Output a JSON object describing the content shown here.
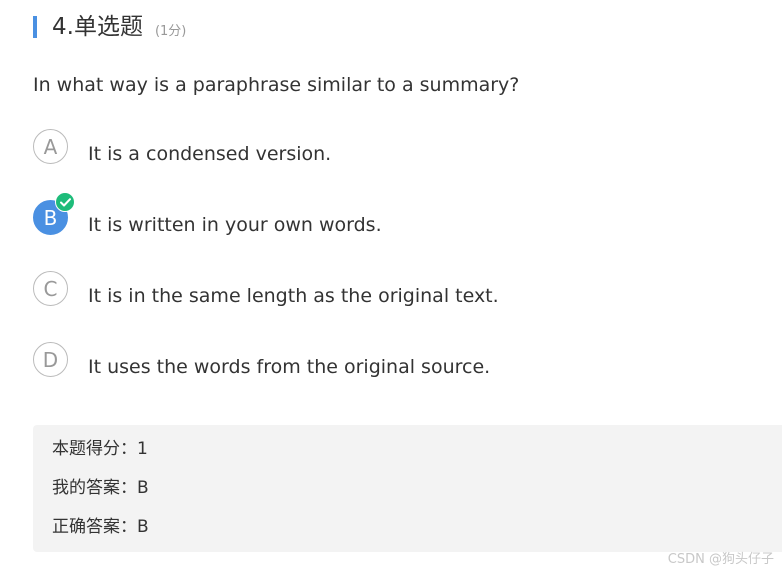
{
  "question": {
    "title": "4.单选题",
    "score": "(1分)",
    "text": "In what way is a paraphrase similar to a summary?"
  },
  "options": [
    {
      "letter": "A",
      "text": "It is a condensed version.",
      "selected": false
    },
    {
      "letter": "B",
      "text": "It is written in your own words.",
      "selected": true
    },
    {
      "letter": "C",
      "text": "It is in the same length as the original text.",
      "selected": false
    },
    {
      "letter": "D",
      "text": "It uses the words from the original source.",
      "selected": false
    }
  ],
  "result": {
    "score_line": "本题得分：1",
    "my_answer_line": "我的答案：B",
    "correct_answer_line": "正确答案：B"
  },
  "watermark": "CSDN @狗头仔子",
  "colors": {
    "accent": "#4a90e2",
    "correct_badge": "#1ebc7a",
    "panel_bg": "#f3f3f3"
  },
  "icons": {
    "selected_badge": "checkmark-icon"
  }
}
